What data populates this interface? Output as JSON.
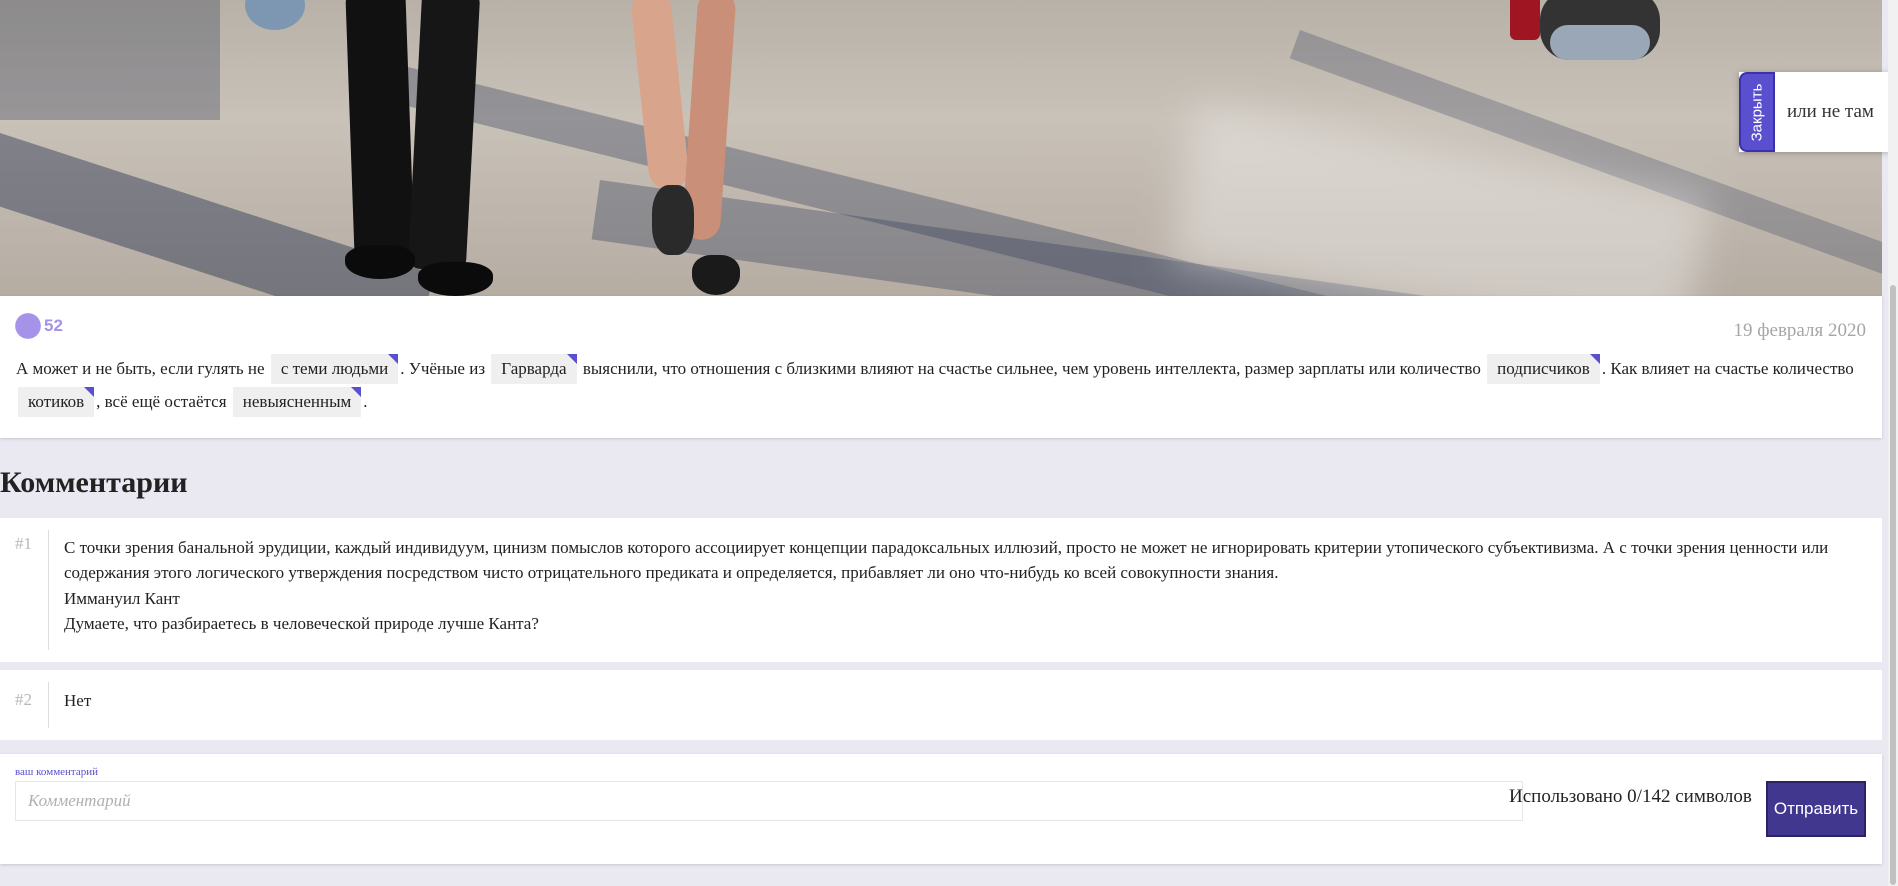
{
  "popup": {
    "close_label": "Закрыть",
    "text": "или не там"
  },
  "post": {
    "likes": "52",
    "date": "19 февраля 2020",
    "text_parts": {
      "p1": "А может и не быть, если гулять не ",
      "tag1": "с теми людьми",
      "p2": ". Учёные из ",
      "tag2": "Гарварда",
      "p3": " выяснили, что отношения с близкими влияют на счастье сильнее, чем уровень интеллекта, размер зарплаты или количество ",
      "tag3": "подписчиков",
      "p4": ". Как влияет на счастье количество ",
      "tag4": "котиков",
      "p5": ", всё ещё остаётся ",
      "tag5": "невыясненным",
      "p6": "."
    }
  },
  "comments": {
    "title": "Комментарии",
    "items": [
      {
        "num": "#1",
        "lines": [
          "С точки зрения банальной эрудиции, каждый индивидуум, цинизм помыслов которого ассоциирует концепции парадоксальных иллюзий, просто не может не игнорировать критерии утопического субъективизма. А с точки зрения ценности или содержания этого логического утверждения посредством чисто отрицательного предиката и определяется, прибавляет ли оно что-нибудь ко всей совокупности знания.",
          "Иммануил Кант",
          "Думаете, что разбираетесь в человеческой природе лучше Канта?"
        ]
      },
      {
        "num": "#2",
        "lines": [
          "Нет"
        ]
      }
    ]
  },
  "form": {
    "label": "ваш комментарий",
    "placeholder": "Комментарий",
    "value": "",
    "char_count": "Использовано 0/142 символов",
    "send_label": "Отправить"
  },
  "colors": {
    "accent": "#5a4fcf",
    "button": "#42378f",
    "heart": "#a493e8",
    "background": "#eae8f1"
  },
  "icons": {
    "like": "heart-icon"
  }
}
